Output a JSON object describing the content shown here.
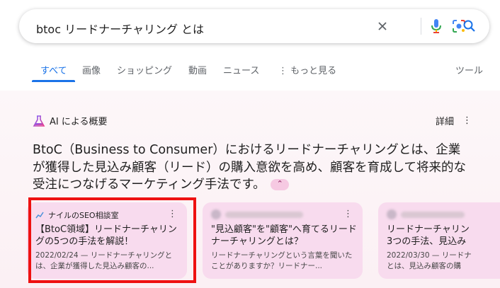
{
  "search": {
    "query": "btoc リードナーチャリング とは"
  },
  "tabs": [
    {
      "label": "すべて"
    },
    {
      "label": "画像"
    },
    {
      "label": "ショッピング"
    },
    {
      "label": "動画"
    },
    {
      "label": "ニュース"
    },
    {
      "label": "もっと見る"
    }
  ],
  "tools_label": "ツール",
  "ai": {
    "header": "AI による概要",
    "detail_label": "詳細",
    "text": "BtoC（Business to Consumer）におけるリードナーチャリングとは、企業が獲得した見込み顧客（リード）の購入意欲を高め、顧客を育成して将来的な受注につなげるマーケティング手法です。"
  },
  "cards": [
    {
      "source": "ナイルのSEO相談室",
      "title": "【BtoC領域】リードナーチャリングの5つの手法を解説！",
      "snippet": "2022/02/24 — リードナーチャリングとは、企業が獲得した見込み顧客の..."
    },
    {
      "source": "",
      "title": "\"見込顧客\"を\"顧客\"へ育てるリードナーチャリングとは？",
      "snippet": "リードナーチャリングという言葉を聞いたことがありますか？リードナー..."
    },
    {
      "source": "",
      "title": "リードナーチャリン 3つの手法、見込み",
      "snippet": "2022/03/30 — リードナ とは、見込み顧客の購"
    }
  ],
  "colors": {
    "accent": "#1a73e8",
    "card_bg": "#f8dbee",
    "highlight": "#ee1111"
  }
}
